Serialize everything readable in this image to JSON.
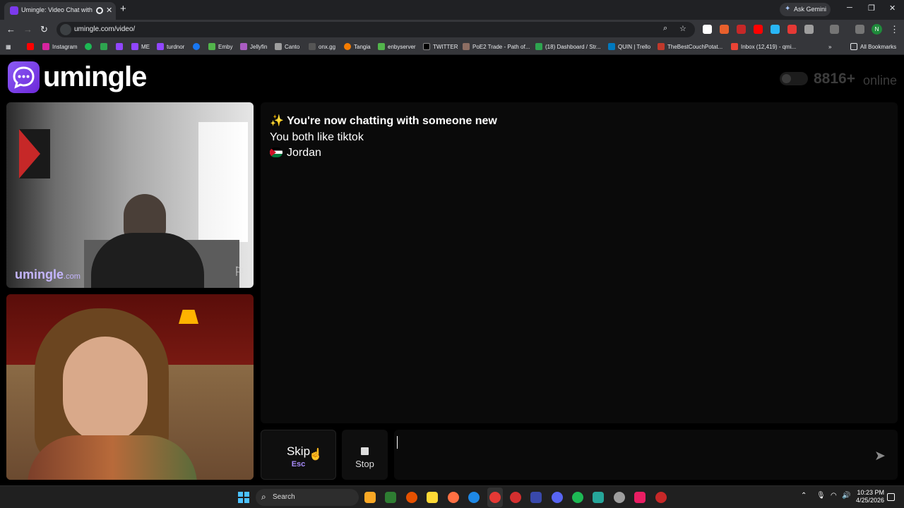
{
  "browser": {
    "tab_title": "Umingle: Video Chat with S",
    "url": "umingle.com/video/",
    "ask_gemini": "Ask Gemini",
    "profile_initial": "N",
    "bookmarks": [
      "Instagram",
      "ME",
      "turdnor",
      "Emby",
      "Jellyfin",
      "Canto",
      "onx.gg",
      "Tangia",
      "enbyserver",
      "TWITTER",
      "PoE2 Trade - Path of...",
      "(18) Dashboard / Str...",
      "QUIN | Trello",
      "TheBestCouchPotat...",
      "Inbox (12,419) - qmi..."
    ],
    "all_bookmarks": "All Bookmarks"
  },
  "header": {
    "logo_text": "umingle",
    "online_count": "8816+",
    "online_label": "online"
  },
  "stranger_video": {
    "watermark_main": "umingle",
    "watermark_sub": ".com"
  },
  "chat": {
    "headline": "✨ You're now chatting with someone new",
    "interest": "You both like tiktok",
    "location": "Jordan"
  },
  "controls": {
    "skip_label": "Skip",
    "skip_key": "Esc",
    "stop_label": "Stop",
    "message_placeholder": ""
  },
  "taskbar": {
    "search_label": "Search",
    "time": "10:23 PM",
    "date": "4/25/2026"
  },
  "colors": {
    "brand_purple": "#7c3aed",
    "background": "#000000",
    "chat_panel": "#0a0a0a"
  }
}
